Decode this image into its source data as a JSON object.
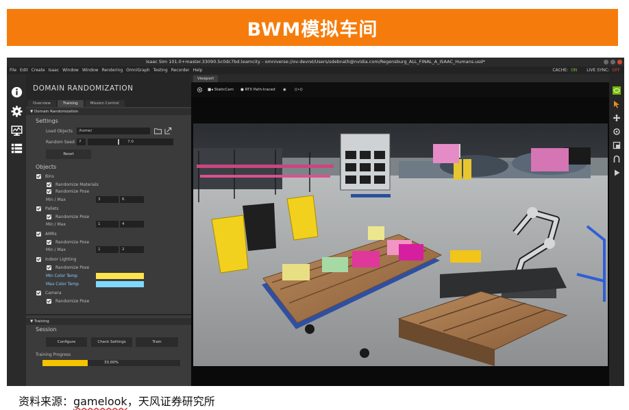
{
  "banner": {
    "title": "BWM模拟车间",
    "color": "#f57c0c"
  },
  "window": {
    "title": "Isaac Sim 101.0+master.33090.5c0dc7bd.teamcity - omniverse://ov-devrel/Users/sdebnath@nvidia.com/Regensburg_ALL_FINAL_A_ISAAC_Humans.usd*"
  },
  "menu": {
    "items": [
      "File",
      "Edit",
      "Create",
      "Isaac",
      "Window",
      "Window",
      "Rendering",
      "OmniGraph",
      "Testing",
      "Recorder",
      "Help"
    ],
    "cache_label": "CACHE:",
    "cache_value": "ON",
    "livesync_label": "LIVE SYNC:",
    "livesync_value": "OFF"
  },
  "left_toolbar": {
    "icons": [
      "info-icon",
      "gear-icon",
      "monitor-chart-icon",
      "list-icon"
    ]
  },
  "panel": {
    "title": "DOMAIN RANDOMIZATION",
    "tabs": [
      "Overview",
      "Training",
      "Mission Control"
    ],
    "active_tab": "Training",
    "section_dr": "Domain Randomization",
    "settings": {
      "heading": "Settings",
      "load_objects_label": "Load Objects",
      "load_objects_value": "/home/",
      "random_seed_label": "Random Seed",
      "random_seed_value": "7",
      "random_seed_slider": "7.0",
      "reset_label": "Reset"
    },
    "objects": {
      "heading": "Objects",
      "bins": {
        "label": "Bins",
        "randomize_materials": "Randomize Materials",
        "randomize_pose": "Randomize Pose",
        "minmax_label": "Min / Max",
        "min": "3",
        "max": "6"
      },
      "pallets": {
        "label": "Pallets",
        "randomize_pose": "Randomize Pose",
        "minmax_label": "Min / Max",
        "min": "1",
        "max": "4"
      },
      "amrs": {
        "label": "AMRs",
        "randomize_pose": "Randomize Pose",
        "minmax_label": "Min / Max",
        "min": "1",
        "max": "2"
      },
      "lighting": {
        "label": "Indoor Lighting",
        "randomize_pose": "Randomize Pose",
        "min_color_label": "Min Color Temp",
        "max_color_label": "Max Color Temp",
        "min_color": "#ffe34d",
        "max_color": "#7fd8ff"
      },
      "camera": {
        "label": "Camera",
        "randomize_pose": "Randomize Pose"
      }
    },
    "training": {
      "section": "Training",
      "session_heading": "Session",
      "configure": "Configure",
      "check_settings": "Check Settings",
      "train": "Train",
      "progress_label": "Training Progress",
      "progress_text": "33.00%",
      "progress_fraction": 0.33
    }
  },
  "viewport": {
    "tab": "Viewport",
    "camera": "StaticCam",
    "render_mode": "RTX Path-traced"
  },
  "right_toolbar": {
    "icons": [
      "nvidia-logo-icon",
      "select-arrow-icon",
      "move-icon",
      "rotate-icon",
      "scale-icon",
      "snap-icon",
      "play-icon"
    ]
  },
  "caption": {
    "prefix": "资料来源：",
    "source": "gamelook",
    "suffix": "，天风证券研究所"
  }
}
